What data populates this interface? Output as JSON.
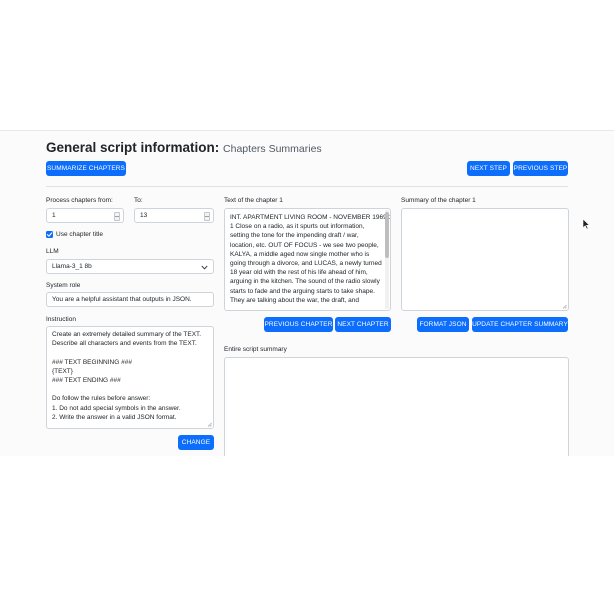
{
  "header": {
    "title": "General script information:",
    "subtitle": "Chapters Summaries"
  },
  "toolbar": {
    "summarize_label": "SUMMARIZE CHAPTERS",
    "next_step_label": "NEXT STEP",
    "previous_step_label": "PREVIOUS STEP"
  },
  "form": {
    "process_from_label": "Process chapters from:",
    "process_from_value": "1",
    "to_label": "To:",
    "to_value": "13",
    "use_title_label": "Use chapter title",
    "use_title_checked": true,
    "llm_label": "LLM",
    "llm_value": "Llama-3_1 8b",
    "system_role_label": "System role",
    "system_role_value": "You are a helpful assistant that outputs in JSON.",
    "instruction_label": "Instruction",
    "instruction_lines": [
      "Create an extremely detailed summary of the TEXT.",
      "Describe all characters and events from the TEXT.",
      "",
      "### TEXT BEGINNING ###",
      "{TEXT}",
      "### TEXT ENDING ###",
      "",
      "Do follow the rules before answer:",
      "1. Do not add special symbols in the answer.",
      "2. Write the answer in a valid JSON format."
    ],
    "change_label": "CHANGE"
  },
  "chapter": {
    "text_label": "Text of the chapter 1",
    "text_lines": [
      "INT. APARTMENT LIVING ROOM - NOVEMBER 1969 1",
      "1 Close on a radio, as it spurts out information,",
      "setting the tone for the impending draft / war,",
      "location, etc. OUT OF FOCUS - we see two people,",
      "KALYA, a middle aged now single mother who is",
      "going through a divorce, and LUCAS, a newly turned",
      "18 year old with the rest of his life ahead of him,",
      "arguing in the kitchen. The sound of the radio slowly",
      "starts to fade and the arguing starts to take shape.",
      "They are talking about the war, the draft, and"
    ],
    "previous_label": "PREVIOUS CHAPTER",
    "next_label": "NEXT CHAPTER"
  },
  "summary": {
    "label": "Summary of the chapter 1",
    "value": "",
    "format_json_label": "FORMAT JSON",
    "update_label": "UPDATE CHAPTER SUMMARY"
  },
  "entire": {
    "label": "Entire script summary",
    "value": ""
  },
  "colors": {
    "primary": "#0d6efd",
    "border": "#ced4da"
  }
}
